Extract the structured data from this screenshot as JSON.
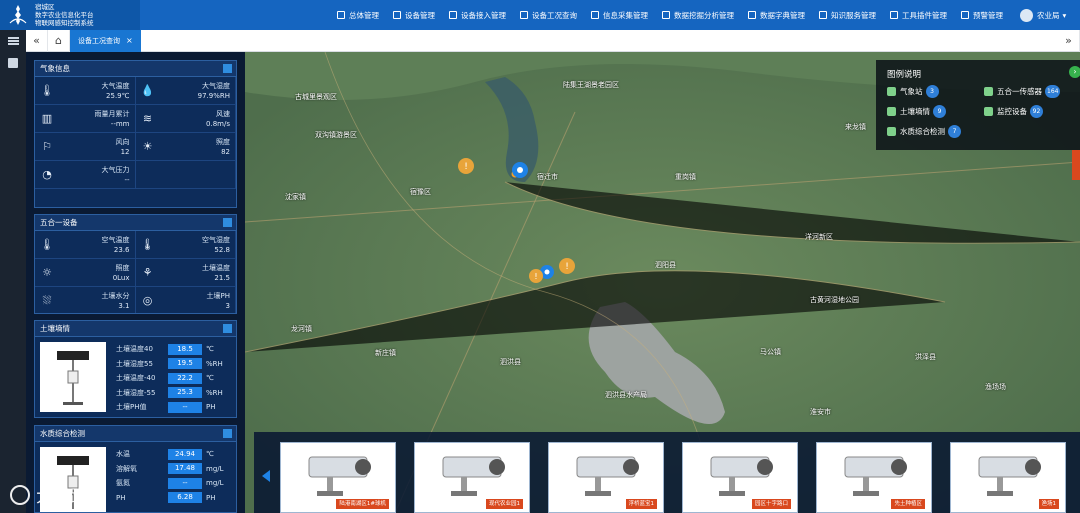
{
  "app": {
    "brand": [
      "宿城区",
      "数字农业信息化平台",
      "物联网感知控制系统"
    ],
    "nav": [
      {
        "label": "总体管理",
        "icon": "grid-icon"
      },
      {
        "label": "设备管理",
        "icon": "device-icon"
      },
      {
        "label": "设备接入管理",
        "icon": "plug-icon"
      },
      {
        "label": "设备工况查询",
        "icon": "chart-icon"
      },
      {
        "label": "信息采集管理",
        "icon": "collect-icon"
      },
      {
        "label": "数据挖掘分析管理",
        "icon": "analysis-icon"
      },
      {
        "label": "数据字典管理",
        "icon": "dictionary-icon"
      },
      {
        "label": "知识服务管理",
        "icon": "star-icon"
      },
      {
        "label": "工具插件管理",
        "icon": "tool-icon"
      },
      {
        "label": "预警管理",
        "icon": "alarm-icon"
      }
    ],
    "user": "农业局",
    "tab": "设备工况查询"
  },
  "weather": {
    "title": "气象信息",
    "cells": [
      {
        "icon": "thermometer-icon",
        "label": "大气温度",
        "value": "25.9℃"
      },
      {
        "icon": "humidity-icon",
        "label": "大气湿度",
        "value": "97.9%RH"
      },
      {
        "icon": "rain-gauge-icon",
        "label": "雨量月累计",
        "value": "--mm"
      },
      {
        "icon": "wind-icon",
        "label": "风速",
        "value": "0.8m/s"
      },
      {
        "icon": "wind-direction-icon",
        "label": "风向",
        "value": "12"
      },
      {
        "icon": "sun-icon",
        "label": "照度",
        "value": "82"
      },
      {
        "icon": "pressure-icon",
        "label": "大气压力",
        "value": "--"
      }
    ]
  },
  "five_in_one": {
    "title": "五合一设备",
    "cells": [
      {
        "icon": "thermometer-icon",
        "label": "空气温度",
        "value": "23.6"
      },
      {
        "icon": "thermometer-icon",
        "label": "空气湿度",
        "value": "52.8"
      },
      {
        "icon": "sun-icon",
        "label": "照度",
        "value": "0Lux"
      },
      {
        "icon": "soil-temp-icon",
        "label": "土壤温度",
        "value": "21.5"
      },
      {
        "icon": "soil-moisture-icon",
        "label": "土壤水分",
        "value": "3.1"
      },
      {
        "icon": "ph-icon",
        "label": "土壤PH",
        "value": "3"
      }
    ]
  },
  "soil": {
    "title": "土壤墒情",
    "rows": [
      {
        "label": "土壤温度40",
        "value": "18.5",
        "unit": "℃"
      },
      {
        "label": "土壤湿度55",
        "value": "19.5",
        "unit": "%RH"
      },
      {
        "label": "土壤温度-40",
        "value": "22.2",
        "unit": "℃"
      },
      {
        "label": "土壤湿度-55",
        "value": "25.3",
        "unit": "%RH"
      },
      {
        "label": "土壤PH值",
        "value": "--",
        "unit": "PH"
      }
    ]
  },
  "water": {
    "title": "水质综合检测",
    "rows": [
      {
        "label": "水温",
        "value": "24.94",
        "unit": "℃"
      },
      {
        "label": "溶解氧",
        "value": "17.48",
        "unit": "mg/L"
      },
      {
        "label": "氨氮",
        "value": "--",
        "unit": "mg/L"
      },
      {
        "label": "PH",
        "value": "6.28",
        "unit": "PH"
      }
    ]
  },
  "legend": {
    "title": "图例说明",
    "items": [
      {
        "label": "气象站",
        "count": "3"
      },
      {
        "label": "五合一传感器",
        "count": "164"
      },
      {
        "label": "土壤墒情",
        "count": "9"
      },
      {
        "label": "监控设备",
        "count": "92"
      },
      {
        "label": "水质综合检测",
        "count": "7"
      }
    ]
  },
  "map_labels": [
    "古城里景观区",
    "双沟镇游景区",
    "陆集王湖景老园区",
    "沈家镇",
    "来龙镇",
    "宿豫区",
    "泗阳县",
    "泗洪县",
    "龙河镇",
    "新庄镇",
    "宿迁市",
    "洋河新区",
    "古黄河湿地公园",
    "泗洪县水产局",
    "马公镇",
    "洪泽县",
    "淮安市",
    "渔场场",
    "重岗镇"
  ],
  "cameras": [
    {
      "label": "陆港南湖区1#球机"
    },
    {
      "label": "现代农业园1"
    },
    {
      "label": "浮桥蓝宝1"
    },
    {
      "label": "园区十字路口"
    },
    {
      "label": "先土种植区"
    },
    {
      "label": "渔场1"
    }
  ],
  "watermark": "大数路境"
}
